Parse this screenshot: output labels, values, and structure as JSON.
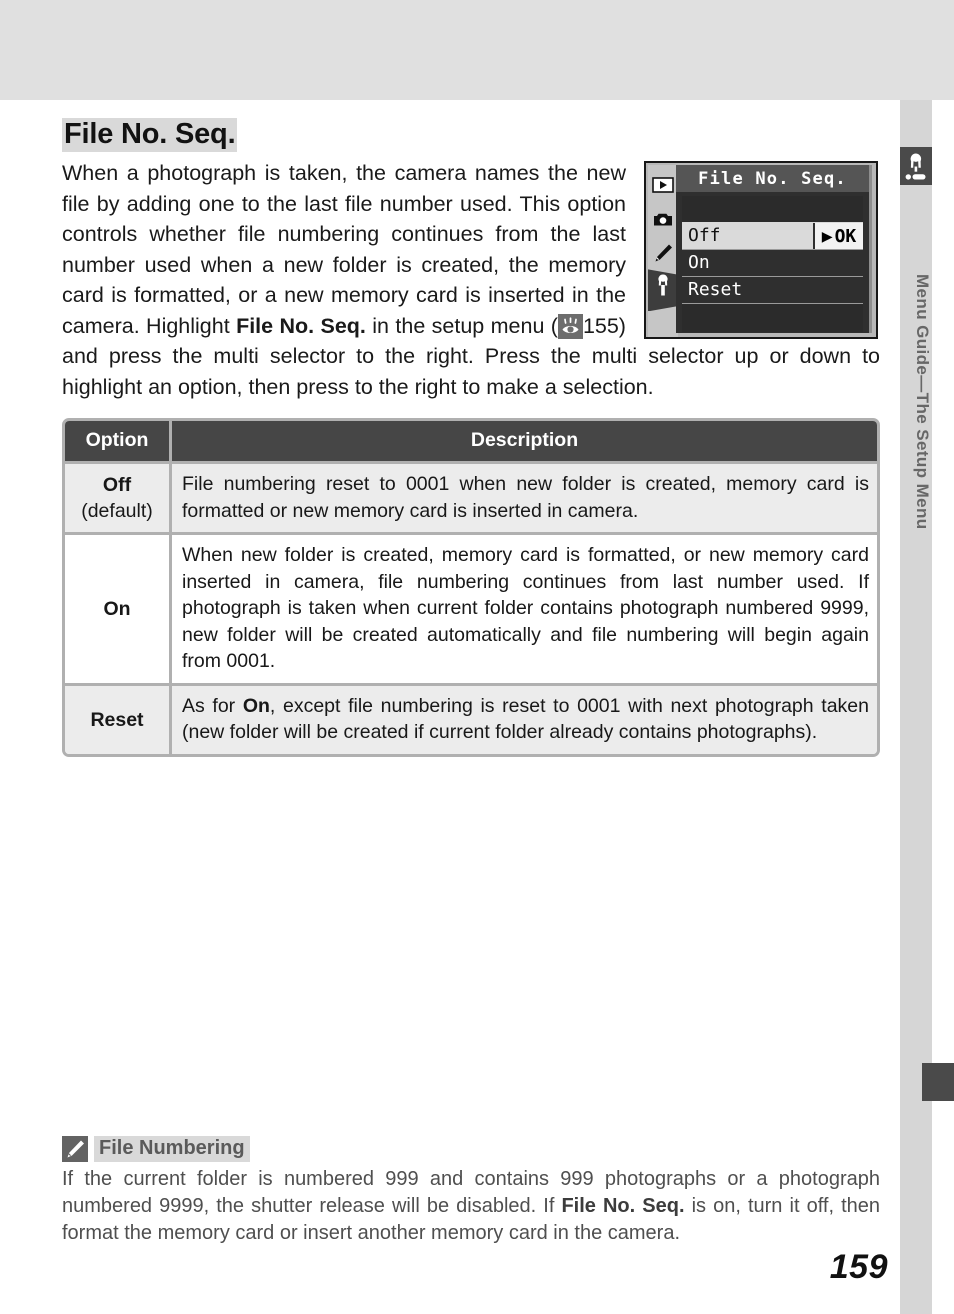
{
  "page": {
    "number": "159",
    "sidebar_title": "Menu Guide—The Setup Menu",
    "sidebar_icon": "wrench-icon",
    "title": "File No. Seq."
  },
  "intro": {
    "part1": "When a photograph is taken, the camera names the new file by adding one to the last file number used.  This option controls whether file numbering continues from the last number used when a new folder is created, the memory card is formatted, or a new memory card is inserted in the camera. Highlight ",
    "bold_term": "File No. Seq.",
    "part2": " in the setup menu (",
    "ref_icon": "see-also-eye-icon",
    "part3": "155) and press the multi selector to the right.  Press the multi selector up or down to highlight an option, then press to the right to make a selection."
  },
  "lcd": {
    "title": "File No. Seq.",
    "icons": [
      "playback-icon",
      "shooting-camera-icon",
      "custom-pencil-icon",
      "setup-wrench-icon"
    ],
    "selected_icon_index": 3,
    "items": [
      {
        "label": "Off",
        "selected": true,
        "badge": "OK",
        "badge_arrow": "▶"
      },
      {
        "label": "On",
        "selected": false
      },
      {
        "label": "Reset",
        "selected": false
      }
    ]
  },
  "table": {
    "headers": {
      "option": "Option",
      "description": "Description"
    },
    "rows": [
      {
        "option": "Off",
        "option_sub": "(default)",
        "shaded": true,
        "description": "File numbering reset to 0001 when new folder is created, memory card is formatted or new memory card is inserted in camera."
      },
      {
        "option": "On",
        "option_sub": "",
        "shaded": false,
        "description": "When new folder is created, memory card is formatted, or new memory card inserted in camera, file numbering continues from last number used. If photograph is taken when current folder contains photograph numbered 9999, new folder will be created automatically and file numbering will begin again from 0001."
      },
      {
        "option": "Reset",
        "option_sub": "",
        "shaded": true,
        "description_pre": "As for ",
        "description_bold": "On",
        "description_post": ", except file numbering is reset to 0001 with next photograph taken (new folder will be created if current folder already contains photographs)."
      }
    ]
  },
  "note": {
    "icon": "pencil-note-icon",
    "title": "File Numbering",
    "body_pre": "If the current folder is numbered 999 and contains 999 photographs or a photograph numbered 9999, the shutter release will be disabled.  If ",
    "body_bold": "File No. Seq.",
    "body_post": " is on, turn it off, then format the memory card or insert another memory card in the camera."
  },
  "colors": {
    "band": "#e0e0e0",
    "rail": "#d6d6d6",
    "dark": "#464646",
    "highlight": "#d9d9d9",
    "shade": "#ececec"
  }
}
